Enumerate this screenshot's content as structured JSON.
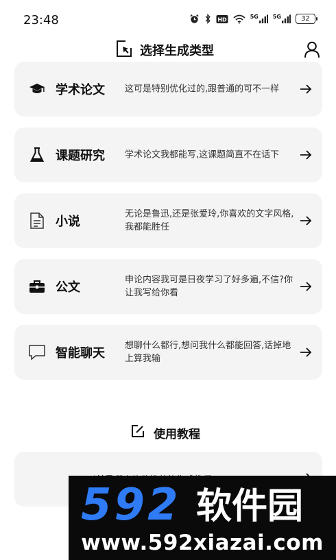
{
  "status_bar": {
    "time": "23:48",
    "network_5g_a": "5G",
    "network_5g_b": "5G",
    "hd_badge": "HD",
    "battery": "32"
  },
  "header": {
    "title": "选择生成类型",
    "logo_icon": "cursor-box-icon",
    "user_icon": "user-icon"
  },
  "cards": [
    {
      "icon": "graduation-cap-icon",
      "title": "学术论文",
      "desc": "这可是特别优化过的,跟普通的可不一样"
    },
    {
      "icon": "flask-icon",
      "title": "课题研究",
      "desc": "学术论文我都能写,这课题简直不在话下"
    },
    {
      "icon": "document-icon",
      "title": "小说",
      "desc": "无论是鲁迅,还是张爱玲,你喜欢的文字风格,我都能胜任"
    },
    {
      "icon": "briefcase-icon",
      "title": "公文",
      "desc": "申论内容我可是日夜学习了好多遍,不信?你让我写给你看"
    },
    {
      "icon": "chat-bubble-icon",
      "title": "智能聊天",
      "desc": "想聊什么都行,想问我什么都能回答,话掉地上算我输"
    }
  ],
  "tutorial": {
    "title": "使用教程",
    "icon": "edit-square-icon",
    "item_text": "以前是哪个软件推荐的生成教程"
  },
  "watermark": {
    "digits": "592",
    "brand": "软件园",
    "url": "www.592xiazai.com",
    "digits_color": "#2f7bf5",
    "brand_color": "#ffffff"
  }
}
